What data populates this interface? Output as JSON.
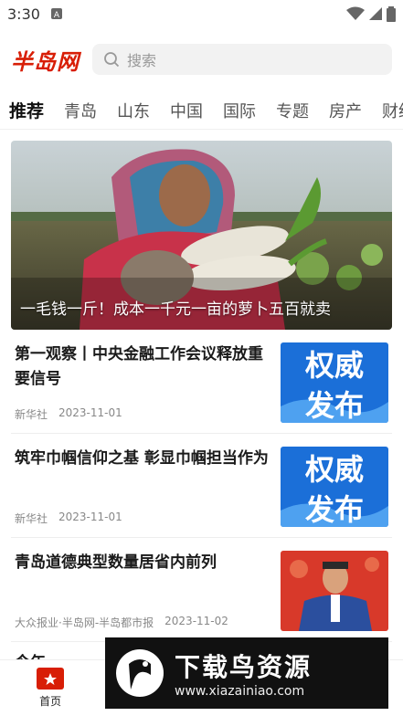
{
  "status": {
    "time": "3:30"
  },
  "header": {
    "logo": "半岛网",
    "search_placeholder": "搜索"
  },
  "tabs": [
    "推荐",
    "青岛",
    "山东",
    "中国",
    "国际",
    "专题",
    "房产",
    "财经"
  ],
  "hero": {
    "caption": "一毛钱一斤！成本一千元一亩的萝卜五百就卖"
  },
  "news": [
    {
      "title": "第一观察丨中央金融工作会议释放重要信号",
      "source": "新华社",
      "date": "2023-11-01",
      "thumb_text": "权威发布"
    },
    {
      "title": "筑牢巾帼信仰之基 彰显巾帼担当作为",
      "source": "新华社",
      "date": "2023-11-01",
      "thumb_text": "权威发布"
    },
    {
      "title": "青岛道德典型数量居省内前列",
      "source": "大众报业·半岛网-半岛都市报",
      "date": "2023-11-02",
      "thumb_text": ""
    }
  ],
  "partial_item": {
    "title": "今年"
  },
  "bottom_nav": [
    {
      "label": "首页"
    },
    {
      "label": ""
    },
    {
      "label": ""
    },
    {
      "label": ""
    }
  ],
  "watermark": {
    "title": "下载鸟资源",
    "url": "www.xiazainiao.com"
  },
  "colors": {
    "brand": "#d81e06",
    "accent_blue": "#1b6fd8"
  }
}
